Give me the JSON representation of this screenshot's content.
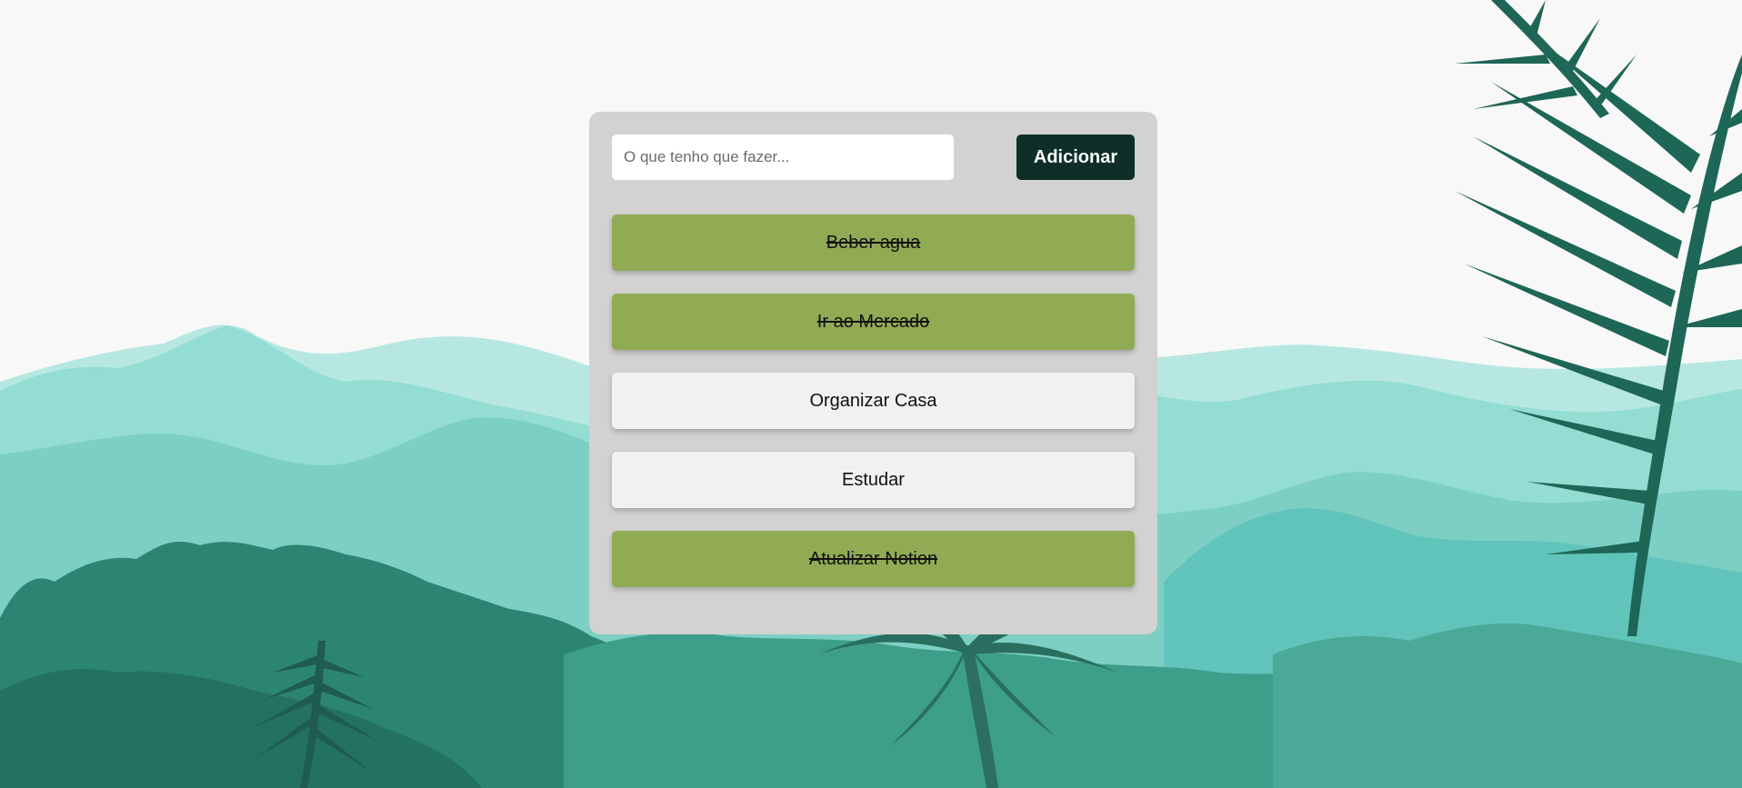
{
  "input": {
    "placeholder": "O que tenho que fazer...",
    "value": ""
  },
  "add_button": {
    "label": "Adicionar"
  },
  "tasks": [
    {
      "label": "Beber agua",
      "completed": true
    },
    {
      "label": "Ir ao Mercado",
      "completed": true
    },
    {
      "label": "Organizar Casa",
      "completed": false
    },
    {
      "label": "Estudar",
      "completed": false
    },
    {
      "label": "Atualizar Notion",
      "completed": true
    }
  ],
  "colors": {
    "panel_bg": "#d2d2d2",
    "completed_task": "#91ab55",
    "pending_task": "#f1f1f1",
    "button_bg": "#0d2f28",
    "page_bg": "#f8f8f8"
  }
}
